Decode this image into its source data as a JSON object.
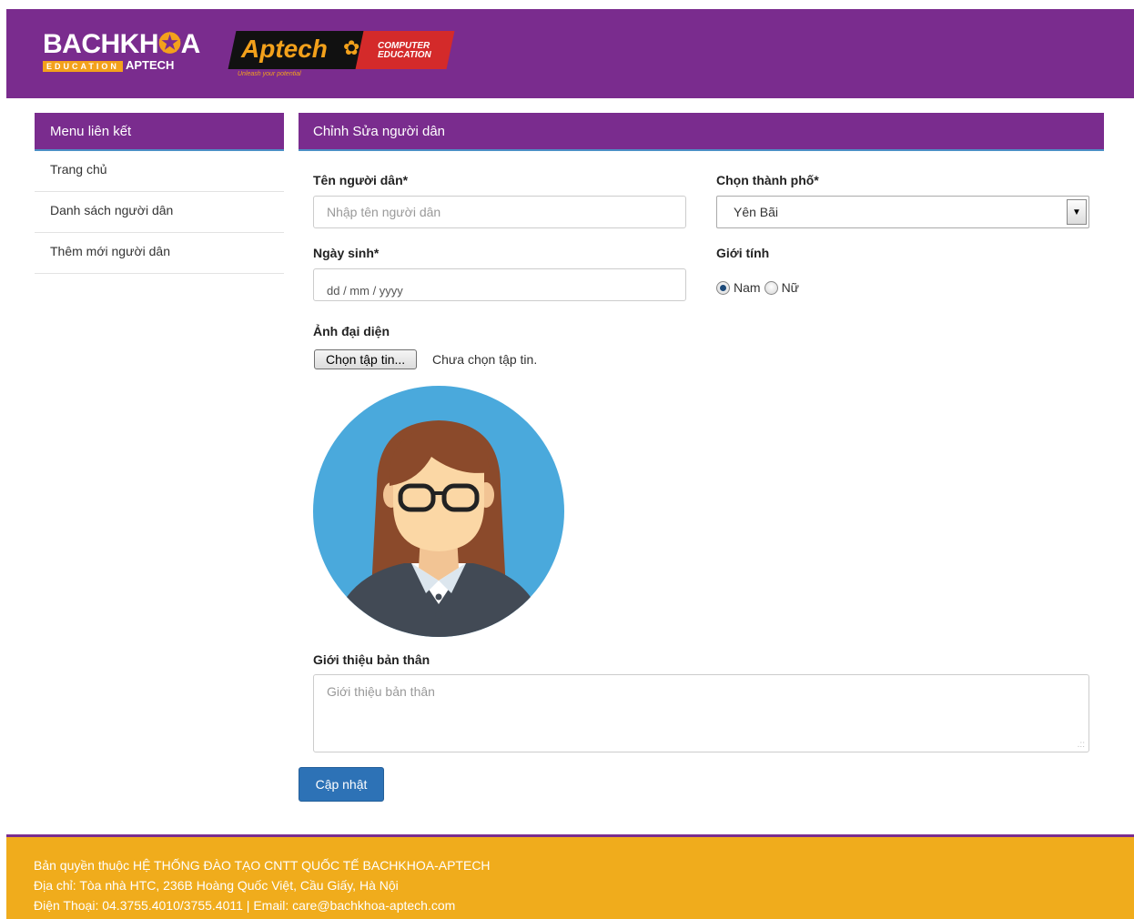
{
  "header": {
    "logo_bachkhoa_main": "BACHKH",
    "logo_bachkhoa_ring": "✪",
    "logo_bachkhoa_end": "A",
    "logo_bachkhoa_edu": "EDUCATION",
    "logo_bachkhoa_aptech": "APTECH",
    "logo_aptech_text": "Aptech",
    "logo_aptech_ce_line1": "COMPUTER",
    "logo_aptech_ce_line2": "EDUCATION",
    "logo_aptech_tagline": "Unleash your potential"
  },
  "sidebar": {
    "title": "Menu liên kết",
    "items": [
      {
        "label": "Trang chủ"
      },
      {
        "label": "Danh sách người dân"
      },
      {
        "label": "Thêm mới người dân"
      }
    ]
  },
  "form": {
    "title": "Chỉnh Sửa người dân",
    "name_label": "Tên người dân*",
    "name_placeholder": "Nhập tên người dân",
    "city_label": "Chọn thành phố*",
    "city_value": "Yên Bãi",
    "dob_label": "Ngày sinh*",
    "dob_placeholder": "dd / mm / yyyy",
    "gender_label": "Giới tính",
    "gender_options": [
      {
        "label": "Nam",
        "checked": true
      },
      {
        "label": "Nữ",
        "checked": false
      }
    ],
    "avatar_label": "Ảnh đại diện",
    "file_button": "Chọn tập tin...",
    "file_status": "Chưa chọn tập tin.",
    "bio_label": "Giới thiệu bản thân",
    "bio_placeholder": "Giới thiệu bản thân",
    "submit_label": "Cập nhật"
  },
  "footer": {
    "line1": "Bản quyền thuộc HỆ THỐNG ĐÀO TẠO CNTT QUỐC TẾ BACHKHOA-APTECH",
    "line2": "Địa chỉ: Tòa nhà HTC, 236B Hoàng Quốc Việt, Cầu Giấy, Hà Nội",
    "line3": "Điện Thoại: 04.3755.4010/3755.4011 | Email: care@bachkhoa-aptech.com"
  },
  "colors": {
    "brand_purple": "#7a2c8e",
    "footer_orange": "#f0ac1c",
    "button_blue": "#2d72b6",
    "avatar_bg": "#4aa9dc"
  }
}
